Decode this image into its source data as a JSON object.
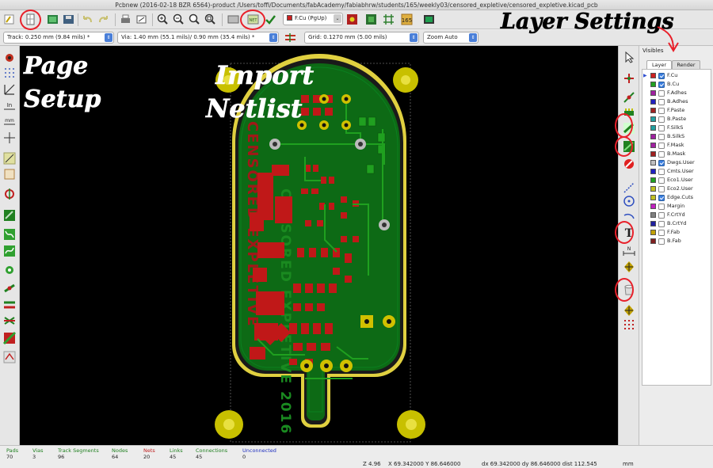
{
  "window": {
    "title": "Pcbnew (2016-02-18 BZR 6564)-product /Users/toffi/Documents/fabAcademy/fabiabhrw/students/165/weekly03/censored_expletive/censored_expletive.kicad_pcb"
  },
  "toolbar2": {
    "track": "Track: 0.250 mm (9.84 mils) *",
    "via": "Via: 1.40 mm (55.1 mils)/ 0.90 mm (35.4 mils) *",
    "grid": "Grid: 0.1270 mm (5.00 mils)",
    "zoom": "Zoom Auto"
  },
  "toolbar1": {
    "active_layer": "F.Cu (PgUp)"
  },
  "panel": {
    "title": "Visibles",
    "tabs": [
      "Layer",
      "Render"
    ],
    "layers": [
      {
        "name": "F.Cu",
        "color": "#cc2020",
        "checked": true,
        "active": true
      },
      {
        "name": "B.Cu",
        "color": "#20a020",
        "checked": true,
        "active": false
      },
      {
        "name": "F.Adhes",
        "color": "#a020a0",
        "checked": false,
        "active": false
      },
      {
        "name": "B.Adhes",
        "color": "#2020c0",
        "checked": false,
        "active": false
      },
      {
        "name": "F.Paste",
        "color": "#a02020",
        "checked": false,
        "active": false
      },
      {
        "name": "B.Paste",
        "color": "#20a0a0",
        "checked": false,
        "active": false
      },
      {
        "name": "F.SilkS",
        "color": "#20a0a0",
        "checked": false,
        "active": false
      },
      {
        "name": "B.SilkS",
        "color": "#a020a0",
        "checked": false,
        "active": false
      },
      {
        "name": "F.Mask",
        "color": "#a020a0",
        "checked": false,
        "active": false
      },
      {
        "name": "B.Mask",
        "color": "#a02020",
        "checked": false,
        "active": false
      },
      {
        "name": "Dwgs.User",
        "color": "#c0c0c0",
        "checked": true,
        "active": false
      },
      {
        "name": "Cmts.User",
        "color": "#2020c0",
        "checked": false,
        "active": false
      },
      {
        "name": "Eco1.User",
        "color": "#20a020",
        "checked": false,
        "active": false
      },
      {
        "name": "Eco2.User",
        "color": "#c0c020",
        "checked": false,
        "active": false
      },
      {
        "name": "Edge.Cuts",
        "color": "#c0c020",
        "checked": true,
        "active": false
      },
      {
        "name": "Margin",
        "color": "#c020c0",
        "checked": false,
        "active": false
      },
      {
        "name": "F.CrtYd",
        "color": "#808080",
        "checked": false,
        "active": false
      },
      {
        "name": "B.CrtYd",
        "color": "#2020a0",
        "checked": false,
        "active": false
      },
      {
        "name": "F.Fab",
        "color": "#c0a000",
        "checked": false,
        "active": false
      },
      {
        "name": "B.Fab",
        "color": "#802020",
        "checked": false,
        "active": false
      }
    ]
  },
  "pcb": {
    "silk_text_1": "CENSORED EXPLETIVE",
    "silk_text_2": "CENSORED EXPLETIVE 2016"
  },
  "status": {
    "columns": [
      {
        "label": "Pads",
        "value": "70",
        "color": "#208020"
      },
      {
        "label": "Vias",
        "value": "3",
        "color": "#208020"
      },
      {
        "label": "Track Segments",
        "value": "96",
        "color": "#208020"
      },
      {
        "label": "Nodes",
        "value": "64",
        "color": "#208020"
      },
      {
        "label": "Nets",
        "value": "20",
        "color": "#c02020"
      },
      {
        "label": "Links",
        "value": "45",
        "color": "#208020"
      },
      {
        "label": "Connections",
        "value": "45",
        "color": "#208020"
      },
      {
        "label": "Unconnected",
        "value": "0",
        "color": "#2030c0"
      }
    ],
    "zoom": "Z 4.96",
    "xy": "X 69.342000  Y 86.646000",
    "dxy": "dx 69.342000  dy 86.646000  dist 112.545",
    "units": "mm"
  },
  "annotations": {
    "page_setup_1": "Page",
    "page_setup_2": "Setup",
    "import_1": "Import",
    "import_2": "Netlist",
    "layer_settings": "Layer Settings",
    "track": "Track",
    "copper_pour": "Copper Pour",
    "text": "Text",
    "delete": "Delete",
    "color": "#000000",
    "circle_color": "#e8202a"
  }
}
